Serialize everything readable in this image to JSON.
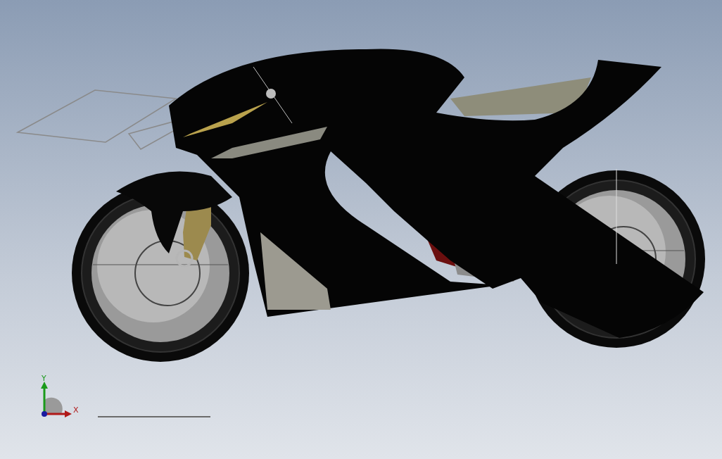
{
  "viewport": {
    "triad": {
      "y_label": "Y",
      "x_label": "X"
    }
  }
}
